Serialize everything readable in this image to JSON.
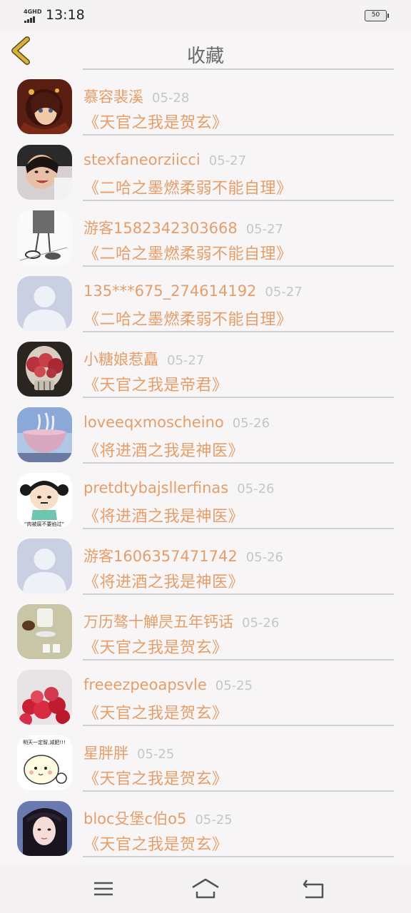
{
  "status_bar": {
    "network": "4GHD",
    "time": "13:18",
    "battery": "50"
  },
  "header": {
    "title": "收藏"
  },
  "items": [
    {
      "name": "慕容裴溪",
      "date": "05-28",
      "book": "《天官之我是贺玄》",
      "avatar": "anime-girl"
    },
    {
      "name": "stexfaneorziicci",
      "date": "05-27",
      "book": "《二哈之墨燃柔弱不能自理》",
      "avatar": "child-photo"
    },
    {
      "name": "游客1582342303668",
      "date": "05-27",
      "book": "《二哈之墨燃柔弱不能自理》",
      "avatar": "sketch-legs"
    },
    {
      "name": "135***675_274614192",
      "date": "05-27",
      "book": "《二哈之墨燃柔弱不能自理》",
      "avatar": "default-person"
    },
    {
      "name": "小糖娘惹矗",
      "date": "05-27",
      "book": "《天官之我是帝君》",
      "avatar": "skull-roses"
    },
    {
      "name": "loveeqxmoscheino",
      "date": "05-26",
      "book": "《将进酒之我是神医》",
      "avatar": "drink-bowl"
    },
    {
      "name": "pretdtybajsllerfinas",
      "date": "05-26",
      "book": "《将进酒之我是神医》",
      "avatar": "cartoon-girl"
    },
    {
      "name": "游客1606357471742",
      "date": "05-26",
      "book": "《将进酒之我是神医》",
      "avatar": "default-person"
    },
    {
      "name": "万历骜十觯昃五年钙话",
      "date": "05-26",
      "book": "《天官之我是贺玄》",
      "avatar": "clothes-flatlay"
    },
    {
      "name": "freeezpeoapsvle",
      "date": "05-25",
      "book": "《天官之我是贺玄》",
      "avatar": "red-balloons"
    },
    {
      "name": "星胖胖",
      "date": "05-25",
      "book": "《天官之我是贺玄》",
      "avatar": "cartoon-sticker"
    },
    {
      "name": "bloc殳堡c伯o5",
      "date": "05-25",
      "book": "《天官之我是贺玄》",
      "avatar": "girl-portrait"
    }
  ],
  "avatar_labels": {
    "cartoon-girl": "“肉被腐不要掐过”",
    "cartoon-sticker": "明天一定智,减肥!!!"
  },
  "colors": {
    "accent": "#e59e6a",
    "date": "#c6c6c6",
    "back": "#d9b13a"
  },
  "nav": {
    "icons": [
      "menu-icon",
      "home-icon",
      "back-arrow-icon"
    ]
  }
}
